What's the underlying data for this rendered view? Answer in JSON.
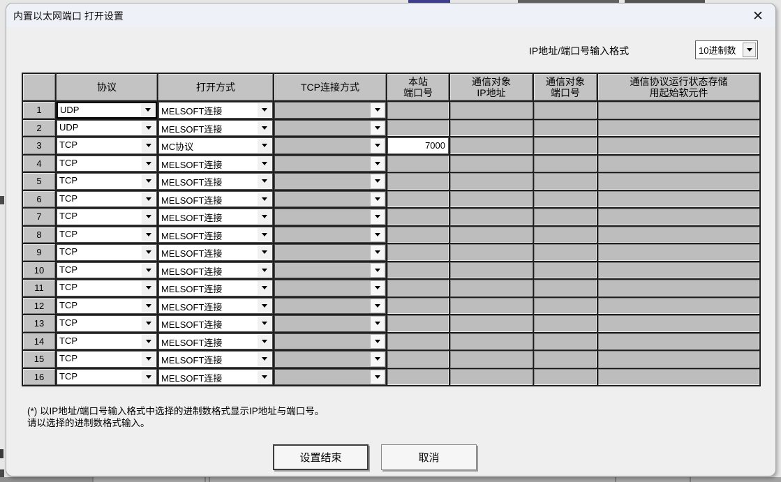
{
  "window": {
    "title": "内置以太网端口 打开设置",
    "close_icon": "✕"
  },
  "format_selector": {
    "label": "IP地址/端口号输入格式",
    "value": "10进制数"
  },
  "table": {
    "headers": [
      "",
      "协议",
      "打开方式",
      "TCP连接方式",
      "本站\n端口号",
      "通信对象\nIP地址",
      "通信对象\n端口号",
      "通信协议运行状态存储\n用起始软元件"
    ],
    "rows": [
      {
        "num": "1",
        "protocol": "UDP",
        "open_method": "MELSOFT连接",
        "local_port": "",
        "selected": true
      },
      {
        "num": "2",
        "protocol": "UDP",
        "open_method": "MELSOFT连接",
        "local_port": ""
      },
      {
        "num": "3",
        "protocol": "TCP",
        "open_method": "MC协议",
        "local_port": "7000"
      },
      {
        "num": "4",
        "protocol": "TCP",
        "open_method": "MELSOFT连接",
        "local_port": ""
      },
      {
        "num": "5",
        "protocol": "TCP",
        "open_method": "MELSOFT连接",
        "local_port": ""
      },
      {
        "num": "6",
        "protocol": "TCP",
        "open_method": "MELSOFT连接",
        "local_port": ""
      },
      {
        "num": "7",
        "protocol": "TCP",
        "open_method": "MELSOFT连接",
        "local_port": ""
      },
      {
        "num": "8",
        "protocol": "TCP",
        "open_method": "MELSOFT连接",
        "local_port": ""
      },
      {
        "num": "9",
        "protocol": "TCP",
        "open_method": "MELSOFT连接",
        "local_port": ""
      },
      {
        "num": "10",
        "protocol": "TCP",
        "open_method": "MELSOFT连接",
        "local_port": ""
      },
      {
        "num": "11",
        "protocol": "TCP",
        "open_method": "MELSOFT连接",
        "local_port": ""
      },
      {
        "num": "12",
        "protocol": "TCP",
        "open_method": "MELSOFT连接",
        "local_port": ""
      },
      {
        "num": "13",
        "protocol": "TCP",
        "open_method": "MELSOFT连接",
        "local_port": ""
      },
      {
        "num": "14",
        "protocol": "TCP",
        "open_method": "MELSOFT连接",
        "local_port": ""
      },
      {
        "num": "15",
        "protocol": "TCP",
        "open_method": "MELSOFT连接",
        "local_port": ""
      },
      {
        "num": "16",
        "protocol": "TCP",
        "open_method": "MELSOFT连接",
        "local_port": ""
      }
    ]
  },
  "footnote": {
    "line1": "(*) 以IP地址/端口号输入格式中选择的进制数格式显示IP地址与端口号。",
    "line2": "请以选择的进制数格式输入。"
  },
  "buttons": {
    "ok": "设置结束",
    "cancel": "取消"
  },
  "colors": {
    "header_gray": "#c3c3c3",
    "disabled_field_gray": "#bdbdbd",
    "grid_line": "#1f1f1f",
    "titlebar": "#eef1f8"
  }
}
